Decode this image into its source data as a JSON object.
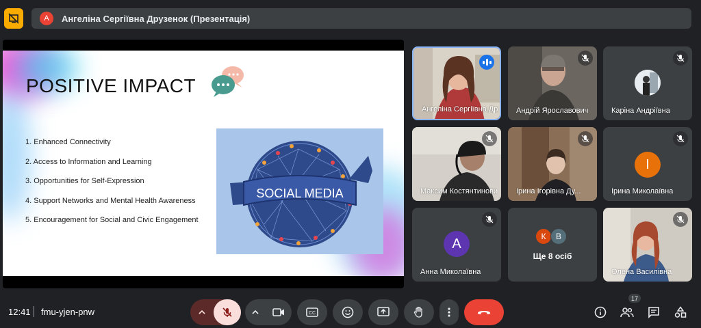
{
  "presenter": {
    "avatar_letter": "А",
    "label": "Ангеліна Сергіївна Друзенок (Презентація)"
  },
  "slide": {
    "title": "POSITIVE IMPACT",
    "items": [
      "1. Enhanced Connectivity",
      "2. Access to Information and Learning",
      "3. Opportunities for Self-Expression",
      "4. Support Networks and Mental Health Awareness",
      "5. Encouragement for Social and Civic Engagement"
    ],
    "banner": "SOCIAL MEDIA"
  },
  "participants": [
    {
      "name": "Ангеліна Сергіївна Друзенок"
    },
    {
      "name": "Андрій Ярославович"
    },
    {
      "name": "Каріна Андріївна"
    },
    {
      "name": "Максим Костянтинович"
    },
    {
      "name": "Ірина Ігорівна Ду..."
    },
    {
      "name": "Ірина Миколаївна",
      "avatar": "I",
      "color": "#e8710a"
    },
    {
      "name": "Анна Миколаївна",
      "avatar": "A",
      "color": "#5e35b1"
    },
    {
      "name": "Олена Василівна"
    }
  ],
  "more": {
    "avatars": [
      "К",
      "В"
    ],
    "label": "Ще 8 осіб"
  },
  "bottom": {
    "time": "12:41",
    "meeting_code": "fmu-yjen-pnw",
    "participants_count": "17"
  },
  "colors": {
    "background": "#202124",
    "tile": "#3c4043",
    "end_call": "#ea4335",
    "mic_off": "#f9dedc",
    "accent": "#8ab4f8"
  }
}
